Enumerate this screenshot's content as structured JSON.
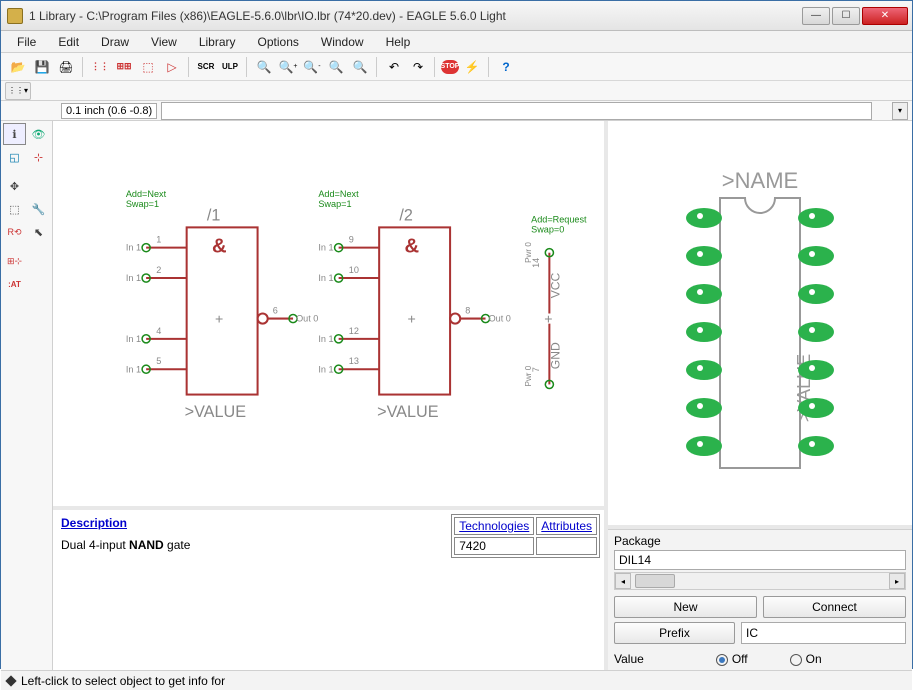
{
  "title": "1 Library - C:\\Program Files (x86)\\EAGLE-5.6.0\\lbr\\IO.lbr (74*20.dev) - EAGLE 5.6.0 Light",
  "menu": [
    "File",
    "Edit",
    "Draw",
    "View",
    "Library",
    "Options",
    "Window",
    "Help"
  ],
  "coord": "0.1 inch (0.6 -0.8)",
  "command": "",
  "status": "Left-click to select object to get info for",
  "desc": {
    "header": "Description",
    "body_prefix": "Dual 4-input ",
    "body_bold": "NAND",
    "body_suffix": " gate",
    "tech_headers": [
      "Technologies",
      "Attributes"
    ],
    "tech_value": "7420"
  },
  "schematic": {
    "gate1": {
      "add": "Add=Next",
      "swap": "Swap=1",
      "name": "/1",
      "sym": "&",
      "value": ">VALUE",
      "pins_left": [
        {
          "lbl": "In 1",
          "num": "1"
        },
        {
          "lbl": "In 1",
          "num": "2"
        },
        {
          "lbl": "In 1",
          "num": "4"
        },
        {
          "lbl": "In 1",
          "num": "5"
        }
      ],
      "pin_right": {
        "lbl": "Out 0",
        "num": "6"
      }
    },
    "gate2": {
      "add": "Add=Next",
      "swap": "Swap=1",
      "name": "/2",
      "sym": "&",
      "value": ">VALUE",
      "pins_left": [
        {
          "lbl": "In 1",
          "num": "9"
        },
        {
          "lbl": "In 1",
          "num": "10"
        },
        {
          "lbl": "In 1",
          "num": "12"
        },
        {
          "lbl": "In 1",
          "num": "13"
        }
      ],
      "pin_right": {
        "lbl": "Out 0",
        "num": "8"
      }
    },
    "power": {
      "add": "Add=Request",
      "swap": "Swap=0",
      "vcc_num": "14",
      "vcc_lbl": "VCC",
      "vcc_dir": "Pwr 0",
      "gnd_num": "7",
      "gnd_lbl": "GND",
      "gnd_dir": "Pwr 0"
    }
  },
  "package": {
    "label": "Package",
    "name": "DIL14",
    "name_lbl": ">NAME",
    "value_lbl": ">VALUE",
    "btn_new": "New",
    "btn_connect": "Connect",
    "btn_prefix": "Prefix",
    "prefix_value": "IC",
    "value_label": "Value",
    "off": "Off",
    "on": "On"
  }
}
